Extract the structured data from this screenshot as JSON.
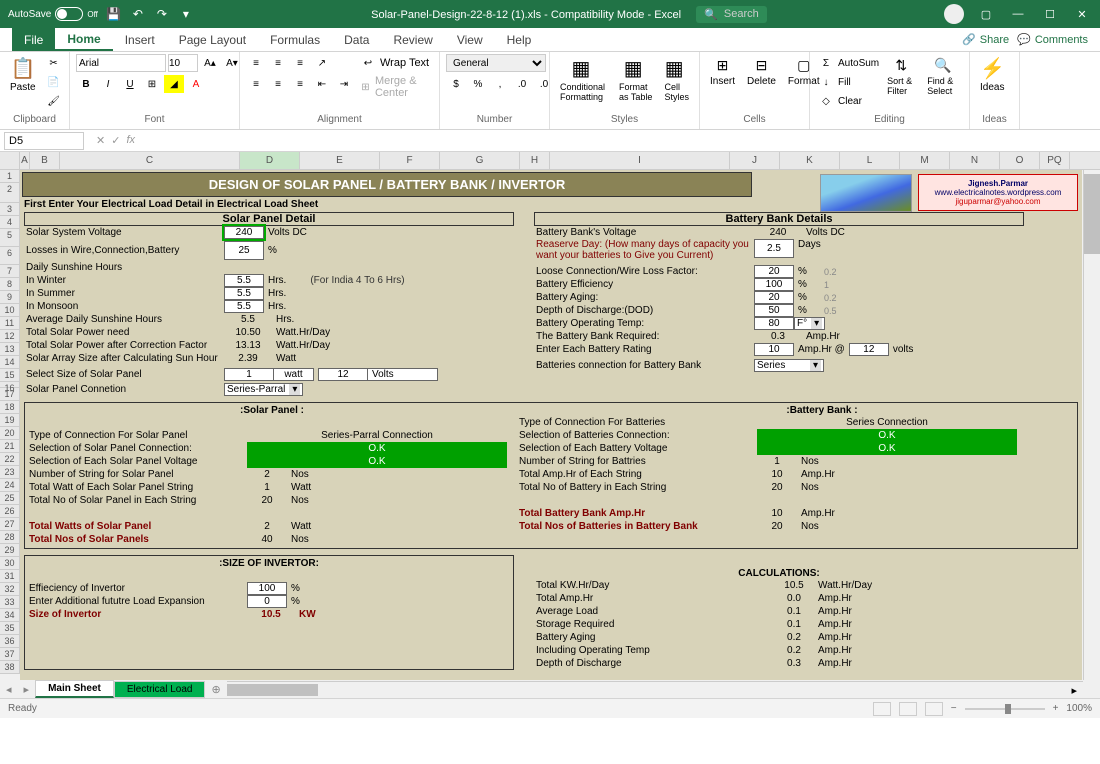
{
  "titlebar": {
    "autosave": "AutoSave",
    "autosave_state": "Off",
    "filename": "Solar-Panel-Design-22-8-12 (1).xls  -  Compatibility Mode  -  Excel",
    "search_placeholder": "Search"
  },
  "tabs": {
    "file": "File",
    "home": "Home",
    "insert": "Insert",
    "page_layout": "Page Layout",
    "formulas": "Formulas",
    "data": "Data",
    "review": "Review",
    "view": "View",
    "help": "Help",
    "share": "Share",
    "comments": "Comments"
  },
  "ribbon": {
    "clipboard": {
      "paste": "Paste",
      "group": "Clipboard"
    },
    "font": {
      "name": "Arial",
      "size": "10",
      "group": "Font"
    },
    "alignment": {
      "wrap": "Wrap Text",
      "merge": "Merge & Center",
      "group": "Alignment"
    },
    "number": {
      "format": "General",
      "group": "Number"
    },
    "styles": {
      "cond": "Conditional Formatting",
      "table": "Format as Table",
      "cell": "Cell Styles",
      "group": "Styles"
    },
    "cells": {
      "insert": "Insert",
      "delete": "Delete",
      "format": "Format",
      "group": "Cells"
    },
    "editing": {
      "autosum": "AutoSum",
      "fill": "Fill",
      "clear": "Clear",
      "sort": "Sort & Filter",
      "find": "Find & Select",
      "group": "Editing"
    },
    "ideas": {
      "ideas": "Ideas",
      "group": "Ideas"
    }
  },
  "formula": {
    "cell_ref": "D5",
    "fx": "fx"
  },
  "col_headers": [
    "A",
    "B",
    "C",
    "D",
    "E",
    "F",
    "G",
    "H",
    "I",
    "J",
    "K",
    "L",
    "M",
    "N",
    "O",
    "PQ"
  ],
  "row_headers": [
    "1",
    "2",
    "3",
    "4",
    "5",
    "6",
    "7",
    "8",
    "9",
    "10",
    "11",
    "12",
    "13",
    "14",
    "15",
    "16",
    "17",
    "18",
    "19",
    "20",
    "21",
    "22",
    "23",
    "24",
    "25",
    "26",
    "27",
    "28",
    "29",
    "30",
    "31",
    "32",
    "33",
    "34",
    "35",
    "36",
    "37",
    "38"
  ],
  "sheet": {
    "main_title": "DESIGN OF SOLAR PANEL / BATTERY BANK / INVERTOR",
    "author": "Jignesh.Parmar",
    "url": "www.electricalnotes.wordpress.com",
    "email": "jiguparmar@yahoo.com",
    "intro": "First Enter Your Electrical Load Detail in Electrical Load Sheet",
    "solar_panel_hdr": "Solar Panel Detail",
    "battery_hdr": "Battery Bank Details",
    "left": {
      "sys_voltage_lbl": "Solar System Voltage",
      "sys_voltage_val": "240",
      "sys_voltage_unit": "Volts DC",
      "losses_lbl": "Losses in Wire,Connection,Battery",
      "losses_val": "25",
      "losses_unit": "%",
      "sunshine_lbl": "Daily Sunshine Hours",
      "winter_lbl": "In Winter",
      "winter_val": "5.5",
      "winter_unit": "Hrs.",
      "winter_note": "(For India 4 To 6 Hrs)",
      "summer_lbl": "In Summer",
      "summer_val": "5.5",
      "summer_unit": "Hrs.",
      "monsoon_lbl": "In Monsoon",
      "monsoon_val": "5.5",
      "monsoon_unit": "Hrs.",
      "avg_lbl": "Average Daily Sunshine Hours",
      "avg_val": "5.5",
      "avg_unit": "Hrs.",
      "power_lbl": "Total Solar Power need",
      "power_val": "10.50",
      "power_unit": "Watt.Hr/Day",
      "corr_lbl": "Total Solar Power after Correction Factor",
      "corr_val": "13.13",
      "corr_unit": "Watt.Hr/Day",
      "array_lbl": "Solar Array Size after Calculating Sun Hour",
      "array_val": "2.39",
      "array_unit": "Watt",
      "select_lbl": "Select Size of Solar Panel",
      "select_watt": "1",
      "select_watt_unit": "watt",
      "select_volts": "12",
      "select_volts_unit": "Volts",
      "conn_lbl": "Solar Panel Connetion",
      "conn_val": "Series-Parral"
    },
    "right": {
      "bank_voltage_lbl": "Battery Bank's Voltage",
      "bank_voltage_val": "240",
      "bank_voltage_unit": "Volts DC",
      "reserve_lbl": "Reaserve Day: (How many days of capacity you want your batteries to Give you Current)",
      "reserve_val": "2.5",
      "reserve_unit": "Days",
      "loss_lbl": "Loose Connection/Wire Loss Factor:",
      "loss_val": "20",
      "loss_unit": "%",
      "loss_calc": "0.2",
      "eff_lbl": "Battery Efficiency",
      "eff_val": "100",
      "eff_unit": "%",
      "eff_calc": "1",
      "aging_lbl": "Battery Aging:",
      "aging_val": "20",
      "aging_unit": "%",
      "aging_calc": "0.2",
      "dod_lbl": "Depth of Discharge:(DOD)",
      "dod_val": "50",
      "dod_unit": "%",
      "dod_calc": "0.5",
      "temp_lbl": "Battery Operating Temp:",
      "temp_val": "80",
      "temp_unit": "F°",
      "req_lbl": "The Battery Bank Required:",
      "req_val": "0.3",
      "req_unit": "Amp.Hr",
      "rating_lbl": "Enter Each Battery Rating",
      "rating_val": "10",
      "rating_unit": "Amp.Hr @",
      "rating_volts": "12",
      "rating_volts_unit": "volts",
      "batt_conn_lbl": "Batteries connection for Battery Bank",
      "batt_conn_val": "Series"
    },
    "sp_results": {
      "hdr": ":Solar Panel :",
      "type_lbl": "Type of Connection For Solar Panel",
      "type_val": "Series-Parral Connection",
      "sel_conn_lbl": "Selection of Solar Panel Connection:",
      "sel_conn_val": "O.K",
      "sel_volt_lbl": "Selection of Each Solar Panel Voltage",
      "sel_volt_val": "O.K",
      "strings_lbl": "Number of String for Solar Panel",
      "strings_val": "2",
      "strings_unit": "Nos",
      "watt_lbl": "Total Watt of Each Solar Panel String",
      "watt_val": "1",
      "watt_unit": "Watt",
      "total_lbl": "Total No of Solar Panel in Each String",
      "total_val": "20",
      "total_unit": "Nos",
      "tw_lbl": "Total Watts of Solar Panel",
      "tw_val": "2",
      "tw_unit": "Watt",
      "tn_lbl": "Total Nos of Solar Panels",
      "tn_val": "40",
      "tn_unit": "Nos"
    },
    "bb_results": {
      "hdr": ":Battery Bank :",
      "type_lbl": "Type of Connection For Batteries",
      "type_val": "Series Connection",
      "sel_conn_lbl": "Selection of Batteries Connection:",
      "sel_conn_val": "O.K",
      "sel_volt_lbl": "Selection of Each Battery Voltage",
      "sel_volt_val": "O.K",
      "strings_lbl": "Number of String for Battries",
      "strings_val": "1",
      "strings_unit": "Nos",
      "amp_lbl": "Total Amp.Hr of Each String",
      "amp_val": "10",
      "amp_unit": "Amp.Hr",
      "total_lbl": "Total No of Battery in Each String",
      "total_val": "20",
      "total_unit": "Nos",
      "ta_lbl": "Total Battery Bank Amp.Hr",
      "ta_val": "10",
      "ta_unit": "Amp.Hr",
      "tn_lbl": "Total Nos of Batteries in Battery Bank",
      "tn_val": "20",
      "tn_unit": "Nos"
    },
    "invertor": {
      "hdr": ":SIZE OF INVERTOR:",
      "eff_lbl": "Effieciency of Invertor",
      "eff_val": "100",
      "eff_unit": "%",
      "exp_lbl": "Enter Additional fututre Load Expansion",
      "exp_val": "0",
      "exp_unit": "%",
      "size_lbl": "Size of Invertor",
      "size_val": "10.5",
      "size_unit": "KW"
    },
    "calc": {
      "hdr": "CALCULATIONS:",
      "kw_lbl": "Total KW.Hr/Day",
      "kw_val": "10.5",
      "kw_unit": "Watt.Hr/Day",
      "amp_lbl": "Total Amp.Hr",
      "amp_val": "0.0",
      "amp_unit": "Amp.Hr",
      "avg_lbl": "Average Load",
      "avg_val": "0.1",
      "avg_unit": "Amp.Hr",
      "stor_lbl": "Storage Required",
      "stor_val": "0.1",
      "stor_unit": "Amp.Hr",
      "aging_lbl": "Battery Aging",
      "aging_val": "0.2",
      "aging_unit": "Amp.Hr",
      "temp_lbl": "Including Operating Temp",
      "temp_val": "0.2",
      "temp_unit": "Amp.Hr",
      "dod_lbl": "Depth of Discharge",
      "dod_val": "0.3",
      "dod_unit": "Amp.Hr"
    }
  },
  "sheet_tabs": {
    "main": "Main Sheet",
    "load": "Electrical Load",
    "add": "+"
  },
  "status": {
    "ready": "Ready",
    "zoom": "100%"
  }
}
